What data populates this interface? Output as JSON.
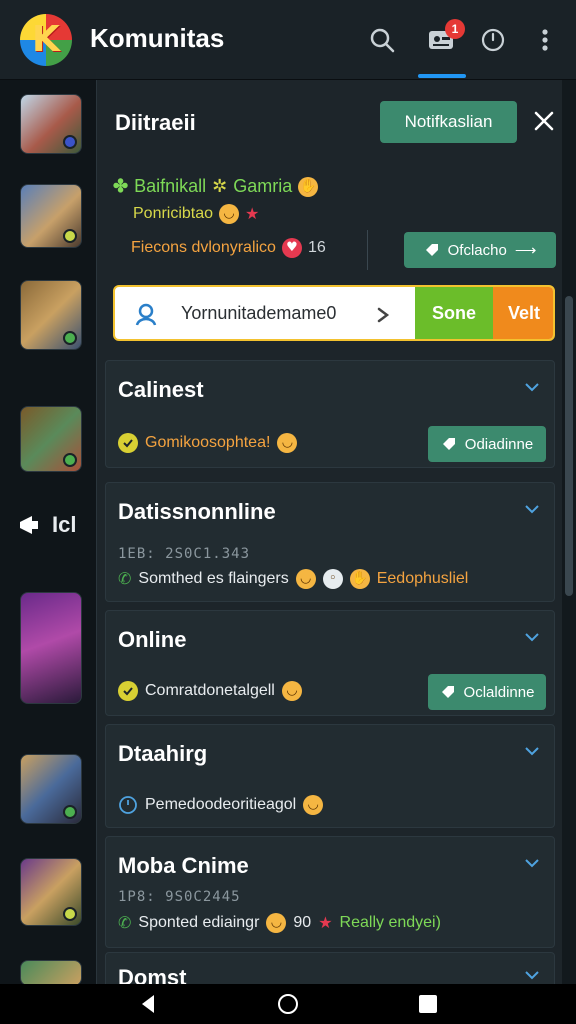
{
  "app": {
    "title": "Komunitas",
    "logo_letter": "K",
    "notification_count": "1"
  },
  "left": {
    "chip_label": "Icl"
  },
  "panel": {
    "title": "Diitraeii",
    "notif_button": "Notifkaslian",
    "status": {
      "line1": "Baifnikall",
      "line1b": "Gamria",
      "line2": "Ponricibtao",
      "line3_label": "Fiecons dvlonyralico",
      "line3_count": "16",
      "action_label": "Ofclacho"
    },
    "namebar": {
      "value": "Yornunitademame0",
      "sone_label": "Sone",
      "velt_label": "Velt"
    },
    "sections": [
      {
        "title": "Calinest",
        "line": "Gomikoosophtea!",
        "action": "Odiadinne"
      },
      {
        "title": "Datissnonnline",
        "meta": "1EB: 2S0C1.343",
        "line": "Somthed es flaingers",
        "extra": "Eedophusliel"
      },
      {
        "title": "Online",
        "line": "Comratdonetalgell",
        "action": "Oclaldinne"
      },
      {
        "title": "Dtaahirg",
        "line": "Pemedoodeoritieagol"
      },
      {
        "title": "Moba Cnime",
        "meta": "1P8: 9S0C2445",
        "line": "Sponted ediaingr",
        "count": "90",
        "extra": "Really endyei)"
      },
      {
        "title": "Domst"
      }
    ]
  },
  "colors": {
    "accent_green": "#3c8a6e",
    "accent_orange": "#f08a1c",
    "accent_lime": "#6bbd2a",
    "tab_indicator": "#2196f3"
  }
}
